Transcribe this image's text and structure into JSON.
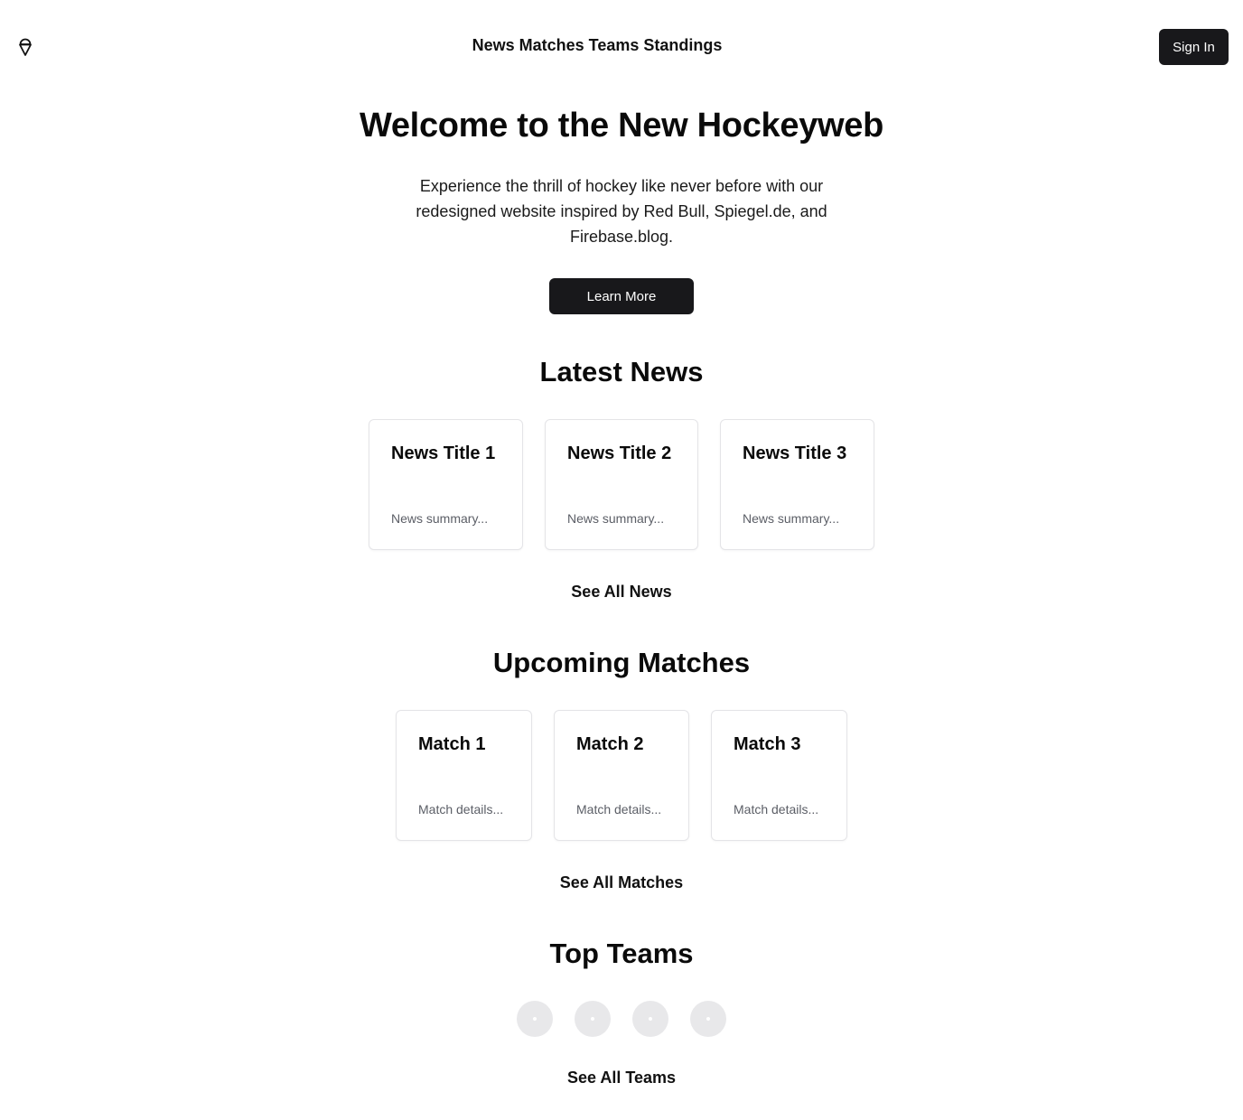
{
  "header": {
    "logo_icon": "ice-cream-cone-icon",
    "nav": [
      "News",
      "Matches",
      "Teams",
      "Standings"
    ],
    "sign_in": "Sign In"
  },
  "hero": {
    "title": "Welcome to the New Hockeyweb",
    "description": "Experience the thrill of hockey like never before with our redesigned website inspired by Red Bull, Spiegel.de, and Firebase.blog.",
    "cta": "Learn More"
  },
  "news": {
    "title": "Latest News",
    "items": [
      {
        "title": "News Title 1",
        "summary": "News summary..."
      },
      {
        "title": "News Title 2",
        "summary": "News summary..."
      },
      {
        "title": "News Title 3",
        "summary": "News summary..."
      }
    ],
    "see_all": "See All News"
  },
  "matches": {
    "title": "Upcoming Matches",
    "items": [
      {
        "title": "Match 1",
        "details": "Match details..."
      },
      {
        "title": "Match 2",
        "details": "Match details..."
      },
      {
        "title": "Match 3",
        "details": "Match details..."
      }
    ],
    "see_all": "See All Matches"
  },
  "teams": {
    "title": "Top Teams",
    "avatar_count": 4,
    "see_all": "See All Teams"
  },
  "colors": {
    "primary_button": "#18181b",
    "muted_text": "#5b5e66",
    "card_border": "#e4e4e7",
    "avatar_placeholder": "#e8e8ea"
  }
}
